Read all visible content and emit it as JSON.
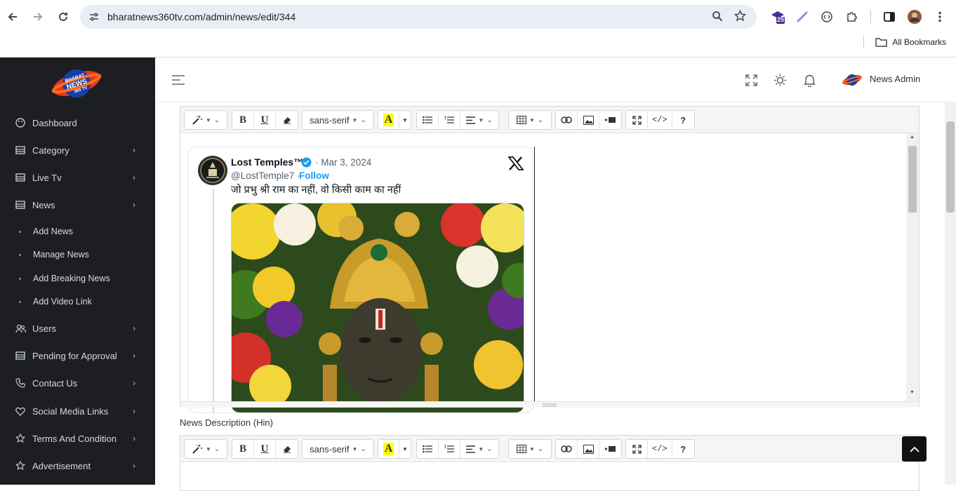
{
  "browser": {
    "url": "bharatnews360tv.com/admin/news/edit/344",
    "ext_badge": "25",
    "bookmarks_label": "All Bookmarks"
  },
  "sidebar": {
    "logo_text": [
      "BHARAT",
      "NEWS",
      "360 TV"
    ],
    "items": [
      {
        "label": "Dashboard",
        "icon": "palette-icon"
      },
      {
        "label": "Category",
        "icon": "table-icon"
      },
      {
        "label": "Live Tv",
        "icon": "table-icon"
      },
      {
        "label": "News",
        "icon": "table-icon"
      },
      {
        "label": "Users",
        "icon": "users-icon"
      },
      {
        "label": "Pending for Approval",
        "icon": "table-icon"
      },
      {
        "label": "Contact Us",
        "icon": "phone-icon"
      },
      {
        "label": "Social Media Links",
        "icon": "heart-icon"
      },
      {
        "label": "Terms And Condition",
        "icon": "star-icon"
      },
      {
        "label": "Advertisement",
        "icon": "star-icon"
      }
    ],
    "news_sub": [
      "Add News",
      "Manage News",
      "Add Breaking News",
      "Add Video Link"
    ]
  },
  "topbar": {
    "user_name": "News Admin"
  },
  "editor": {
    "font_select": "sans-serif",
    "tweet": {
      "name": "Lost Temples™",
      "date": "· Mar 3, 2024",
      "handle": "@LostTemple7 ·",
      "follow": "Follow",
      "text": "जो प्रभु श्री राम का नहीं, वो किसी काम का नहीं"
    }
  },
  "labels": {
    "news_description_hin": "News Description (Hin)"
  },
  "colors": {
    "sidebar_bg": "#1d1e23",
    "twitter_blue": "#1d9bf0"
  }
}
